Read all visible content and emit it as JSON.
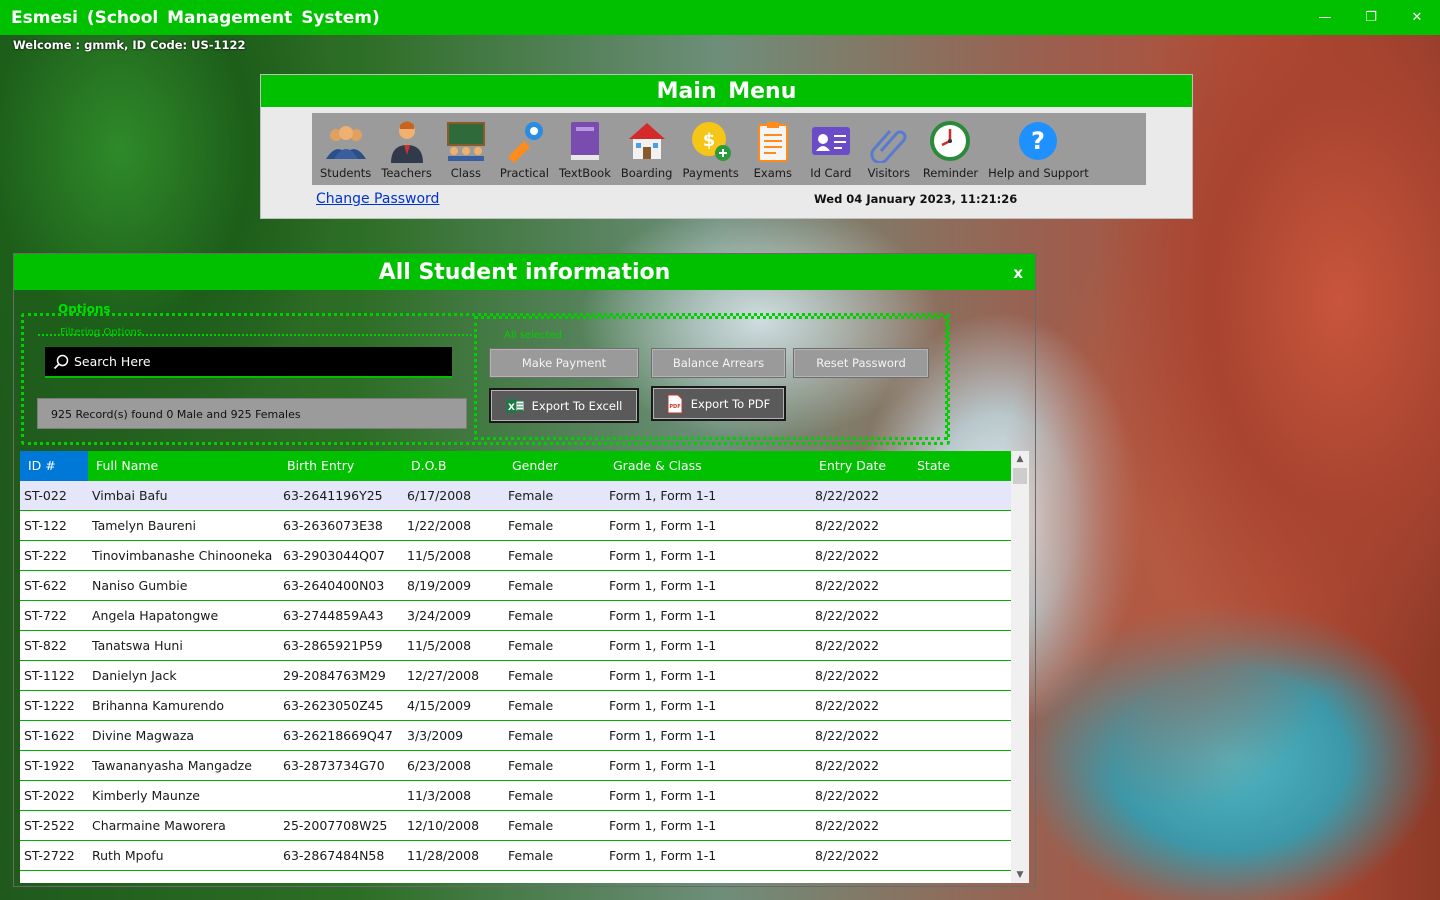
{
  "app": {
    "title": "Esmesi  (School  Management  System)",
    "window_controls": {
      "minimize": "—",
      "restore": "❐",
      "close": "✕"
    }
  },
  "welcome": "Welcome : gmmk, ID Code: US-1122",
  "main_menu": {
    "title": "Main  Menu",
    "items": [
      {
        "label": "Students",
        "icon": "students-icon"
      },
      {
        "label": "Teachers",
        "icon": "teacher-icon"
      },
      {
        "label": "Class",
        "icon": "classroom-icon"
      },
      {
        "label": "Practical",
        "icon": "practical-icon"
      },
      {
        "label": "TextBook",
        "icon": "book-icon"
      },
      {
        "label": "Boarding",
        "icon": "house-icon"
      },
      {
        "label": "Payments",
        "icon": "coin-icon"
      },
      {
        "label": "Exams",
        "icon": "clipboard-icon"
      },
      {
        "label": "Id Card",
        "icon": "id-card-icon"
      },
      {
        "label": "Visitors",
        "icon": "paperclip-icon"
      },
      {
        "label": "Reminder",
        "icon": "clock-icon"
      },
      {
        "label": "Help and Support",
        "icon": "help-icon"
      }
    ],
    "change_password": "Change Password",
    "datetime": "Wed 04 January 2023, 11:21:26"
  },
  "student_window": {
    "title": "All Student information",
    "close": "x",
    "options_label": "Options",
    "filtering_label": "Filtering Options",
    "actions_label": "All selected",
    "search_placeholder": "Search Here",
    "record_count": "925 Record(s) found 0 Male and 925 Females",
    "buttons": {
      "make_payment": "Make Payment",
      "balance_arrears": "Balance Arrears",
      "reset_password": "Reset Password",
      "export_excel": "Export To Excell",
      "export_pdf": "Export To PDF"
    },
    "columns": [
      "ID #",
      "Full Name",
      "Birth Entry",
      "D.O.B",
      "Gender",
      "Grade & Class",
      "Entry Date",
      "State"
    ],
    "rows": [
      [
        "ST-022",
        "Vimbai Bafu",
        "63-2641196Y25",
        "6/17/2008",
        "Female",
        "Form 1, Form 1-1",
        "8/22/2022",
        ""
      ],
      [
        "ST-122",
        "Tamelyn Baureni",
        "63-2636073E38",
        "1/22/2008",
        "Female",
        "Form 1, Form 1-1",
        "8/22/2022",
        ""
      ],
      [
        "ST-222",
        "Tinovimbanashe Chinooneka",
        "63-2903044Q07",
        "11/5/2008",
        "Female",
        "Form 1, Form 1-1",
        "8/22/2022",
        ""
      ],
      [
        "ST-622",
        "Naniso Gumbie",
        "63-2640400N03",
        "8/19/2009",
        "Female",
        "Form 1, Form 1-1",
        "8/22/2022",
        ""
      ],
      [
        "ST-722",
        "Angela Hapatongwe",
        "63-2744859A43",
        "3/24/2009",
        "Female",
        "Form 1, Form 1-1",
        "8/22/2022",
        ""
      ],
      [
        "ST-822",
        "Tanatswa Huni",
        "63-2865921P59",
        "11/5/2008",
        "Female",
        "Form 1, Form 1-1",
        "8/22/2022",
        ""
      ],
      [
        "ST-1122",
        "Danielyn Jack",
        "29-2084763M29",
        "12/27/2008",
        "Female",
        "Form 1, Form 1-1",
        "8/22/2022",
        ""
      ],
      [
        "ST-1222",
        "Brihanna Kamurendo",
        "63-2623050Z45",
        "4/15/2009",
        "Female",
        "Form 1, Form 1-1",
        "8/22/2022",
        ""
      ],
      [
        "ST-1622",
        "Divine Magwaza",
        "63-26218669Q47",
        "3/3/2009",
        "Female",
        "Form 1, Form 1-1",
        "8/22/2022",
        ""
      ],
      [
        "ST-1922",
        "Tawananyasha Mangadze",
        "63-2873734G70",
        "6/23/2008",
        "Female",
        "Form 1, Form 1-1",
        "8/22/2022",
        ""
      ],
      [
        "ST-2022",
        "Kimberly  Maunze",
        "",
        "11/3/2008",
        "Female",
        "Form 1, Form 1-1",
        "8/22/2022",
        ""
      ],
      [
        "ST-2522",
        "Charmaine Maworera",
        "25-2007708W25",
        "12/10/2008",
        "Female",
        "Form 1, Form 1-1",
        "8/22/2022",
        ""
      ],
      [
        "ST-2722",
        "Ruth Mpofu",
        "63-2867484N58",
        "11/28/2008",
        "Female",
        "Form 1, Form 1-1",
        "8/22/2022",
        ""
      ]
    ]
  },
  "colors": {
    "accent_green": "#00c000",
    "selected_header": "#0078d7",
    "selected_row": "#e6e6fa"
  }
}
